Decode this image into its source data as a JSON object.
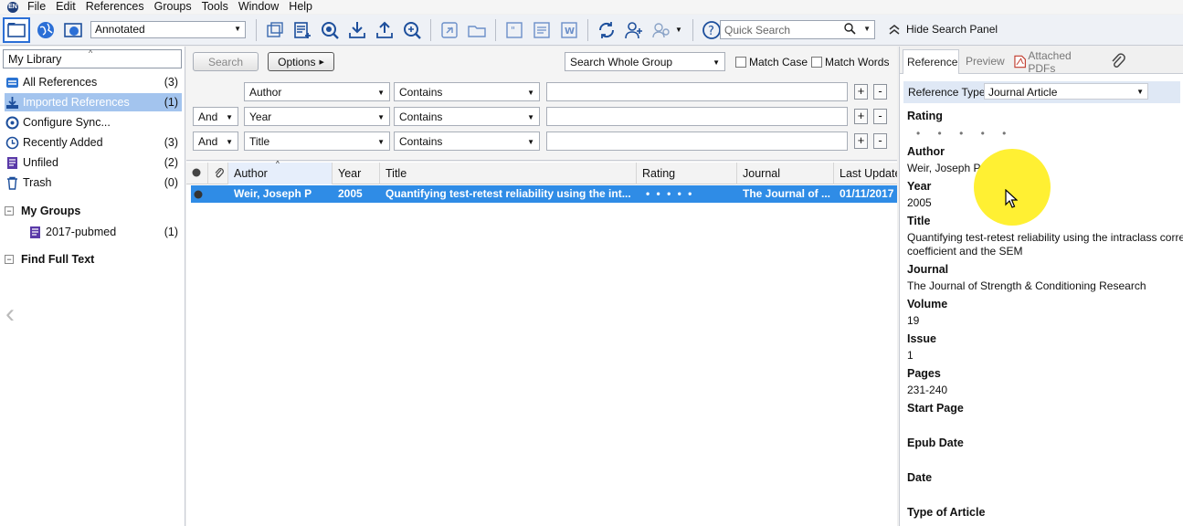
{
  "menu": {
    "app_icon_text": "EN",
    "items": [
      "File",
      "Edit",
      "References",
      "Groups",
      "Tools",
      "Window",
      "Help"
    ]
  },
  "toolbar": {
    "style_value": "Annotated",
    "quick_search_placeholder": "Quick Search",
    "hide_search_panel_label": "Hide Search Panel",
    "icons": [
      "local-library-icon",
      "online-search-icon",
      "integrated-library-icon",
      "copy-to-library-icon",
      "new-reference-icon",
      "online-search-mode-icon",
      "import-icon",
      "export-icon",
      "find-full-text-icon",
      "open-link-icon",
      "open-file-icon",
      "insert-citation-icon",
      "format-bibliography-icon",
      "word-icon",
      "sync-icon",
      "share-group-icon",
      "group-users-icon",
      "help-icon"
    ]
  },
  "library": {
    "header": "My Library",
    "groups": [
      {
        "label": "All References",
        "count": "(3)",
        "icon": "all-references-icon"
      },
      {
        "label": "Imported References",
        "count": "(1)",
        "icon": "imported-references-icon"
      },
      {
        "label": "Configure Sync...",
        "count": "",
        "icon": "sync-icon"
      },
      {
        "label": "Recently Added",
        "count": "(3)",
        "icon": "clock-icon"
      },
      {
        "label": "Unfiled",
        "count": "(2)",
        "icon": "unfiled-icon"
      },
      {
        "label": "Trash",
        "count": "(0)",
        "icon": "trash-icon"
      }
    ],
    "my_groups_label": "My Groups",
    "my_groups": [
      {
        "label": "2017-pubmed",
        "count": "(1)"
      }
    ],
    "find_full_text_label": "Find Full Text"
  },
  "search": {
    "search_button": "Search",
    "options_button": "Options",
    "scope_value": "Search Whole Group",
    "match_case_label": "Match Case",
    "match_words_label": "Match Words",
    "rows": [
      {
        "bool": "",
        "field": "Author",
        "op": "Contains",
        "value": ""
      },
      {
        "bool": "And",
        "field": "Year",
        "op": "Contains",
        "value": ""
      },
      {
        "bool": "And",
        "field": "Title",
        "op": "Contains",
        "value": ""
      }
    ],
    "plus": "+",
    "minus": "-"
  },
  "reflist": {
    "columns": [
      "Author",
      "Year",
      "Title",
      "Rating",
      "Journal",
      "Last Updated"
    ],
    "rows": [
      {
        "author": "Weir, Joseph P",
        "year": "2005",
        "title": "Quantifying test-retest reliability using the int...",
        "rating": "• • • • •",
        "journal": "The Journal of ...",
        "updated": "01/11/2017"
      }
    ]
  },
  "details": {
    "tabs": [
      "Reference",
      "Preview",
      "Attached PDFs"
    ],
    "ref_type_label": "Reference Type:",
    "ref_type_value": "Journal Article",
    "fields": {
      "rating_label": "Rating",
      "rating_dots": "• • • • •",
      "author_label": "Author",
      "author_value": "Weir, Joseph P",
      "year_label": "Year",
      "year_value": "2005",
      "title_label": "Title",
      "title_line1": "Quantifying test-retest reliability using the intraclass correlation",
      "title_line2": "coefficient and the SEM",
      "journal_label": "Journal",
      "journal_value": "The Journal of Strength & Conditioning Research",
      "volume_label": "Volume",
      "volume_value": "19",
      "issue_label": "Issue",
      "issue_value": "1",
      "pages_label": "Pages",
      "pages_value": "231-240",
      "start_page_label": "Start Page",
      "epub_date_label": "Epub Date",
      "date_label": "Date",
      "type_of_article_label": "Type of Article"
    }
  },
  "colors": {
    "selection": "#2f8ce6",
    "group_selected": "#a3c4ee",
    "highlight": "#ffec00"
  }
}
